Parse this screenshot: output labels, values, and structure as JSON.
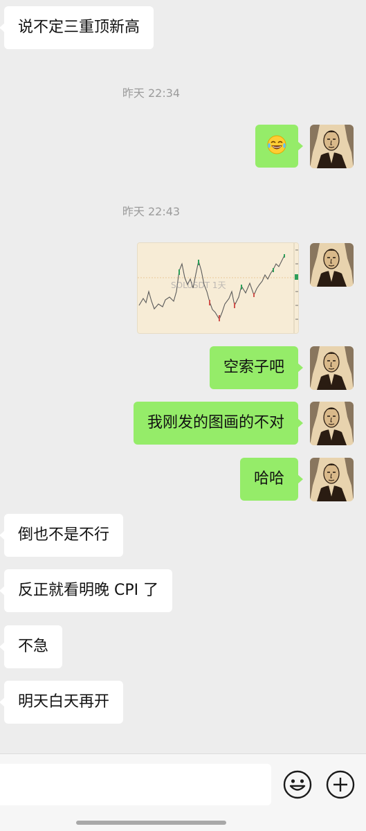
{
  "messages": {
    "m1": "说不定三重顶新高",
    "ts1": "昨天 22:34",
    "m2_emoji": "laughing-tears-emoji",
    "ts2": "昨天 22:43",
    "chart_watermark": "SOLUSDT 1天",
    "m3": "空索子吧",
    "m4": "我刚发的图画的不对",
    "m5": "哈哈",
    "m6": "倒也不是不行",
    "m7": "反正就看明晚 CPI 了",
    "m8": "不急",
    "m9": "明天白天再开"
  },
  "input": {
    "value": "",
    "emoji_button_icon": "smiley-icon",
    "plus_button_icon": "plus-circle-icon"
  },
  "colors": {
    "background": "#ededed",
    "outgoing_bubble": "#95ec69",
    "incoming_bubble": "#ffffff",
    "timestamp": "#9b9b9b"
  }
}
